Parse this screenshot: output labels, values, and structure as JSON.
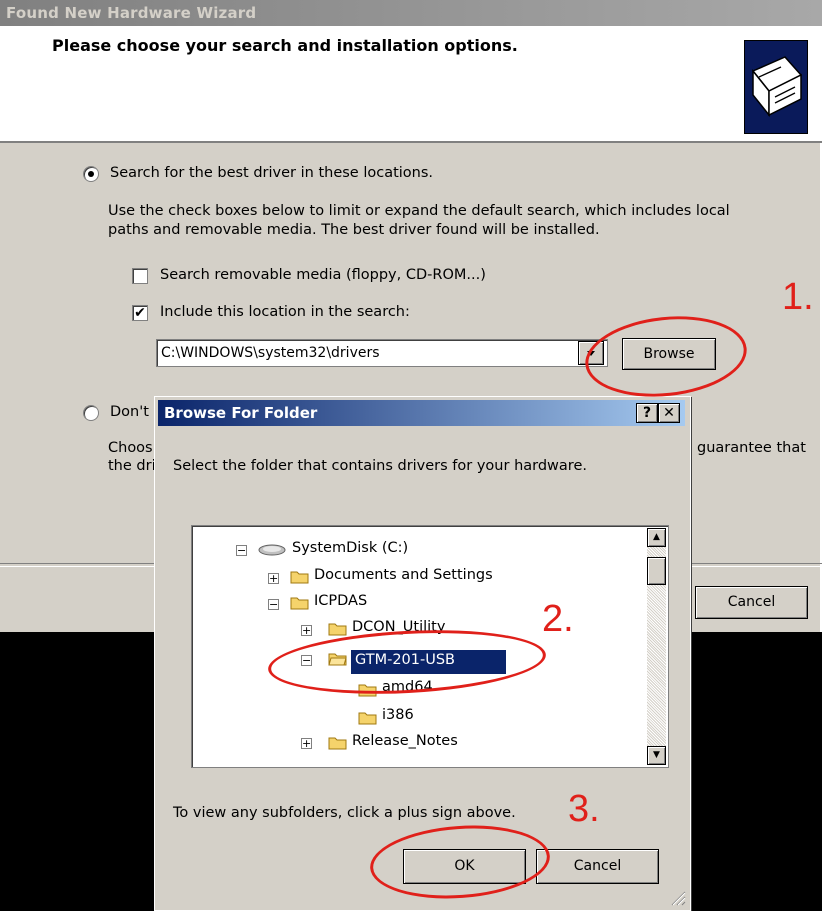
{
  "wizard": {
    "title": "Found New Hardware Wizard",
    "heading": "Please choose your search and installation options.",
    "radio_search_label": "Search for the best driver in these locations.",
    "search_desc_line1": "Use the check boxes below to limit or expand the default search, which includes local",
    "search_desc_line2": "paths and removable media. The best driver found will be installed.",
    "check_removable_label": "Search removable media (floppy, CD-ROM...)",
    "check_location_label": "Include this location in the search:",
    "path_value": "C:\\WINDOWS\\system32\\drivers",
    "browse_label": "Browse",
    "radio_dont_label": "Don't",
    "choose_line_partial": "Choos",
    "choose_line_right": "guarantee that",
    "driver_line_partial": "the dri",
    "cancel_label": "Cancel"
  },
  "browse_dialog": {
    "title": "Browse For Folder",
    "help_label": "?",
    "close_label": "✕",
    "instruction": "Select the folder that contains drivers for your hardware.",
    "tree": [
      {
        "label": "SystemDisk (C:)",
        "toggle": "⊟",
        "icon": "drive-icon"
      },
      {
        "label": "Documents and Settings",
        "toggle": "⊞",
        "icon": "folder-icon"
      },
      {
        "label": "ICPDAS",
        "toggle": "⊟",
        "icon": "folder-icon"
      },
      {
        "label": "DCON_Utility",
        "toggle": "⊞",
        "icon": "folder-icon"
      },
      {
        "label": "GTM-201-USB",
        "toggle": "⊟",
        "icon": "folder-open-icon",
        "selected": true
      },
      {
        "label": "amd64",
        "toggle": "",
        "icon": "folder-icon"
      },
      {
        "label": "i386",
        "toggle": "",
        "icon": "folder-icon"
      },
      {
        "label": "Release_Notes",
        "toggle": "⊞",
        "icon": "folder-icon"
      }
    ],
    "hint": "To view any subfolders, click a plus sign above.",
    "ok_label": "OK",
    "cancel_label": "Cancel"
  },
  "annotations": {
    "step1": "1.",
    "step2": "2.",
    "step3": "3.",
    "color": "#e0201a"
  },
  "colors": {
    "dialog_face": "#d4d0c8",
    "title_active": "#0a246a",
    "selection": "#0a246a",
    "folder": "#f5d36b"
  }
}
